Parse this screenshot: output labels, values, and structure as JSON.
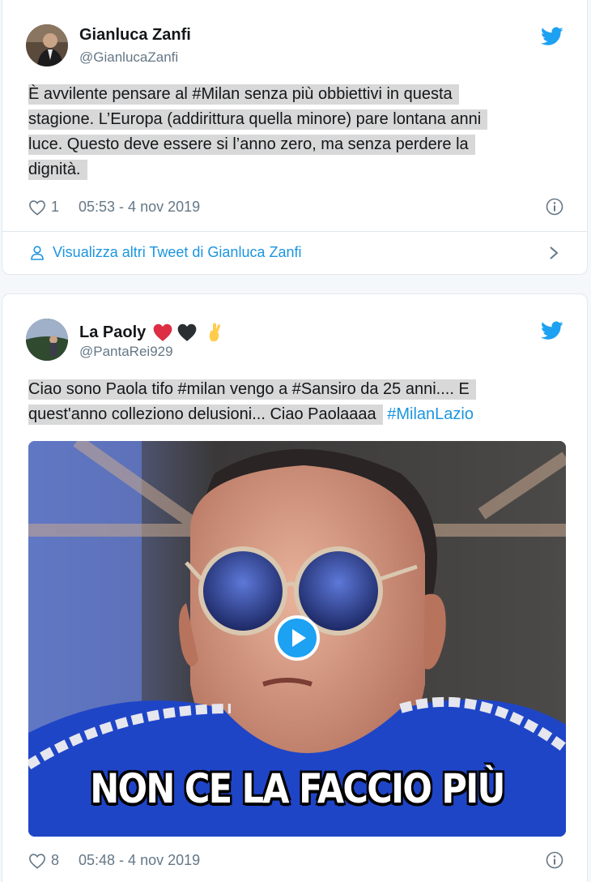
{
  "tweets": [
    {
      "name": "Gianluca Zanfi",
      "handle": "@GianlucaZanfi",
      "text_lines": [
        "È avvilente pensare al #Milan senza più obbiettivi in questa",
        "stagione. L’Europa (addirittura quella minore) pare lontana anni",
        "luce. Questo deve essere si l’anno zero, ma senza perdere la",
        "dignità."
      ],
      "likes": "1",
      "timestamp": "05:53 - 4 nov 2019",
      "more_link": "Visualizza altri Tweet di Gianluca Zanfi"
    },
    {
      "name": "La Paoly",
      "name_emoji": [
        "red-heart",
        "black-heart",
        "crossed-fingers"
      ],
      "handle": "@PantaRei929",
      "text_line1": "Ciao sono Paola tifo #milan  vengo a #Sansiro da 25 anni.... E",
      "text_line2_plain": "quest'anno colleziono delusioni... Ciao Paolaaaa",
      "text_line2_hashtag": "#MilanLazio",
      "media_caption": "NON CE LA FACCIO PIÙ",
      "likes": "8",
      "timestamp": "05:48 - 4 nov 2019"
    }
  ],
  "colors": {
    "twitter_blue": "#1da1f2",
    "link_blue": "#1b95e0",
    "secondary_text": "#657786",
    "highlight": "#d8d8d8"
  }
}
